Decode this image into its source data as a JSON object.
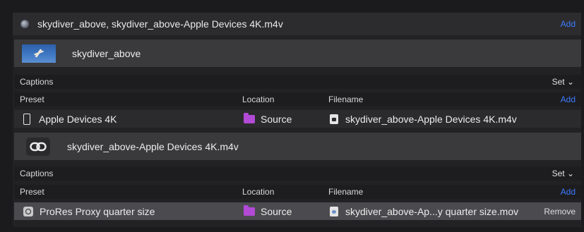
{
  "job": {
    "title": "skydiver_above, skydiver_above-Apple Devices 4K.m4v",
    "add_label": "Add"
  },
  "sources": [
    {
      "name": "skydiver_above",
      "captions_label": "Captions",
      "set_label": "Set ⌄",
      "columns": {
        "preset": "Preset",
        "location": "Location",
        "filename": "Filename",
        "add": "Add"
      },
      "outputs": [
        {
          "preset": "Apple Devices 4K",
          "location": "Source",
          "filename": "skydiver_above-Apple Devices 4K.m4v"
        }
      ]
    },
    {
      "name": "skydiver_above-Apple Devices 4K.m4v",
      "captions_label": "Captions",
      "set_label": "Set ⌄",
      "columns": {
        "preset": "Preset",
        "location": "Location",
        "filename": "Filename",
        "add": "Add"
      },
      "outputs": [
        {
          "preset": "ProRes Proxy quarter size",
          "location": "Source",
          "filename": "skydiver_above-Ap...y quarter size.mov",
          "remove_label": "Remove"
        }
      ]
    }
  ],
  "icons": {
    "job": "compressor-icon",
    "source1": "video-thumbnail",
    "source2": "link-icon",
    "preset1": "iphone-icon",
    "preset2": "prores-icon",
    "location": "purple-folder-icon",
    "file": "document-icon"
  },
  "colors": {
    "accent": "#3d7bff",
    "folder": "#b24ad6",
    "selected_row": "#4b4b4f"
  }
}
